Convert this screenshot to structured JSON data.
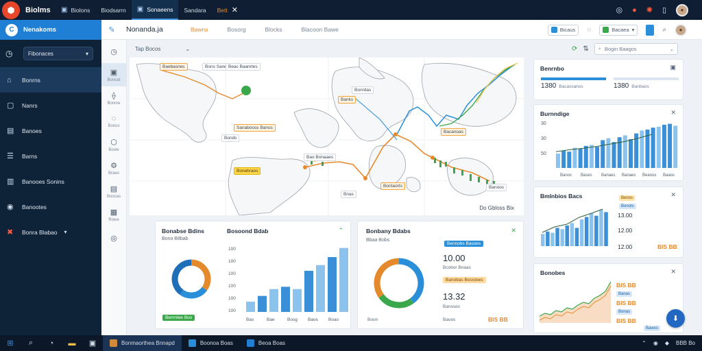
{
  "window": {
    "app_name": "Biolms",
    "tabs": [
      {
        "label": "Biolons"
      },
      {
        "label": "Biodsarrn"
      },
      {
        "label": "Sonaeens"
      },
      {
        "label": "Sandara"
      },
      {
        "label": "Bett"
      }
    ]
  },
  "sidebar": {
    "brand": "Nenakoms",
    "select_value": "Fibonaces",
    "items": [
      {
        "label": "Bonrns",
        "icon": "home-icon"
      },
      {
        "label": "Nanrs",
        "icon": "square-icon"
      },
      {
        "label": "Banoes",
        "icon": "clipboard-icon"
      },
      {
        "label": "Barns",
        "icon": "list-icon"
      },
      {
        "label": "Banooes Sonins",
        "icon": "chart-icon"
      },
      {
        "label": "Banootes",
        "icon": "compass-icon"
      },
      {
        "label": "Bonra Blabao",
        "icon": "tools-icon"
      }
    ]
  },
  "header": {
    "title": "Nonanda.ja",
    "tabs": [
      "Bawns",
      "Bosorg",
      "Blocks",
      "Blacoon Bawe"
    ],
    "active_tab": 0,
    "button1": "Bicaus",
    "button2": "Bacaea"
  },
  "rail": [
    "Bonoat",
    "Bonme",
    "Bonus",
    "Boole",
    "Braeo",
    "Boocas",
    "Rowe"
  ],
  "map": {
    "toolbar_label": "Tap Bocos",
    "search_placeholder": "Bogin Baagos",
    "labels": [
      "Baebasnes",
      "Bons Sanes",
      "Beac Baanrtes",
      "Bonrdas",
      "Banks",
      "Sanabooss Banos",
      "Bacanoas",
      "Bonebraos",
      "Bao Bonaaes",
      "Bnas",
      "Bontaorts",
      "Banoos",
      "Bonds"
    ],
    "footer": "Do Gbloss Bix"
  },
  "right": {
    "panel1": {
      "title": "Benrnbo",
      "stat_a": "1380",
      "stat_a_sub": "Bacassanos",
      "stat_b": "1380",
      "stat_b_sub": "Banbaos"
    },
    "panel2": {
      "title": "Burnndige",
      "y_ticks": [
        "30",
        "30",
        "50"
      ],
      "x_labels": [
        "Banos",
        "Bases",
        "Banaes",
        "Banaes",
        "Beanos",
        "Baaos"
      ],
      "bars": [
        30,
        36,
        34,
        42,
        40,
        46,
        48,
        44,
        58,
        62,
        54,
        64,
        68,
        60,
        72,
        78,
        80,
        84,
        86,
        90,
        92,
        88
      ],
      "trend": [
        34,
        38,
        41,
        45,
        50,
        55,
        62,
        70
      ]
    },
    "panel3": {
      "title": "Bmlnbios Bacs",
      "values": [
        "13.00",
        "12.00",
        "12.00"
      ],
      "tag1": "Benos",
      "tag2": "Bonots",
      "highlight": "BIS BB",
      "bars": [
        20,
        24,
        22,
        30,
        28,
        34,
        38,
        30,
        44,
        48,
        54,
        50,
        60,
        56
      ]
    },
    "panel4": {
      "title": "Bonobes",
      "values": [
        "BIS BB",
        "BIS BB",
        "BIS BB"
      ],
      "rows": [
        "Banas",
        "Bonas",
        "Bawos"
      ],
      "line": [
        10,
        14,
        12,
        18,
        16,
        22,
        20,
        26,
        30,
        28,
        36,
        40,
        46,
        60
      ]
    }
  },
  "bottom": {
    "panel1": {
      "title": "Bonabse Bdins",
      "subtitle": "Bono B8bab",
      "donut": [
        35,
        25,
        40
      ],
      "legend": "Bemntee Boo",
      "bar_title": "Bosoond Bdab",
      "y_ticks": [
        "100",
        "100",
        "100",
        "100",
        "100",
        "100"
      ],
      "x_labels": [
        "Bas",
        "Bae",
        "Bosg",
        "Baos",
        "Boas"
      ],
      "bars": [
        18,
        28,
        40,
        44,
        40,
        72,
        82,
        96,
        112
      ]
    },
    "panel2": {
      "title": "Bonbany Bdabs",
      "subtitle": "Bbaa Bobs",
      "donut": [
        40,
        25,
        35
      ],
      "chip": "Bennobs Basoes",
      "value_a": "10.00",
      "value_a_sub": "Bcobor Bnaas",
      "chip2": "Banobas Boostees",
      "value_b": "13.32",
      "value_b_sub": "Bansses",
      "legend_a": "Boon",
      "legend_b": "Baoos",
      "legend_c": "BIS BB"
    }
  },
  "taskbar": {
    "apps": [
      "Bonmaorthea Bnnapd",
      "Boonoa Boas",
      "Beoa Boas"
    ],
    "right_text": "BBB Bo"
  },
  "colors": {
    "accent": "#2a8fd8",
    "orange": "#e58a2c",
    "green": "#3aa84a",
    "dark": "#0f2338"
  }
}
